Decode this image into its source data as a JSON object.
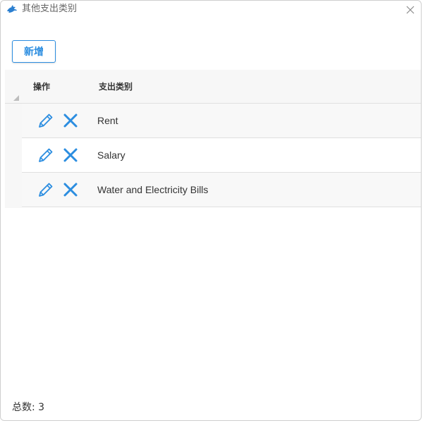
{
  "window": {
    "title": "其他支出类别"
  },
  "toolbar": {
    "add_label": "新增"
  },
  "table": {
    "columns": [
      "操作",
      "支出类别"
    ],
    "rows": [
      {
        "category": "Rent"
      },
      {
        "category": "Salary"
      },
      {
        "category": "Water and Electricity Bills"
      }
    ]
  },
  "footer": {
    "total_label": "总数:",
    "total_value": "3"
  },
  "colors": {
    "accent": "#2b8de0",
    "header_bg": "#f7f7f7",
    "border": "#e0e0e0"
  }
}
